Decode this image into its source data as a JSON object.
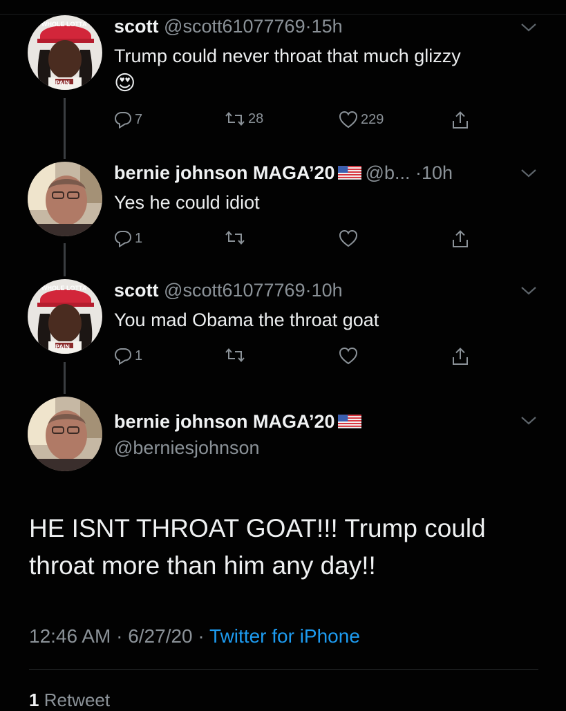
{
  "tweets": [
    {
      "name": "scott",
      "handle": "@scott61077769",
      "dot": "·",
      "time": "15h",
      "text": "Trump could never throat that much glizzy",
      "emoji": "😍",
      "replies": "7",
      "retweets": "28",
      "likes": "229",
      "hat_text": "WHOLE LOTTA",
      "shirt_text": "PAIN"
    },
    {
      "name": "bernie johnson MAGA’20",
      "handle": "@b...",
      "dot": "·",
      "time": "10h",
      "text": "Yes he could idiot",
      "replies": "1",
      "retweets": "",
      "likes": ""
    },
    {
      "name": "scott",
      "handle": "@scott61077769",
      "dot": "·",
      "time": "10h",
      "text": "You mad Obama the throat goat",
      "replies": "1",
      "retweets": "",
      "likes": "",
      "hat_text": "WHOLE LOTTA",
      "shirt_text": "PAIN"
    }
  ],
  "main_tweet": {
    "name": "bernie johnson MAGA’20",
    "handle": "@berniesjohnson",
    "text": "HE ISNT THROAT GOAT!!! Trump could throat more than him any day!!",
    "time": "12:46 AM",
    "dot1": "·",
    "date": "6/27/20",
    "dot2": "·",
    "source": "Twitter for iPhone",
    "retweet_count": "1",
    "retweet_label": "Retweet"
  },
  "colors": {
    "background": "#020202",
    "text": "#e7e9ea",
    "muted": "#8b9298",
    "link": "#1d9bf0"
  },
  "icons": [
    "reply-icon",
    "retweet-icon",
    "like-icon",
    "share-icon",
    "chevron-down-icon",
    "us-flag-icon"
  ]
}
